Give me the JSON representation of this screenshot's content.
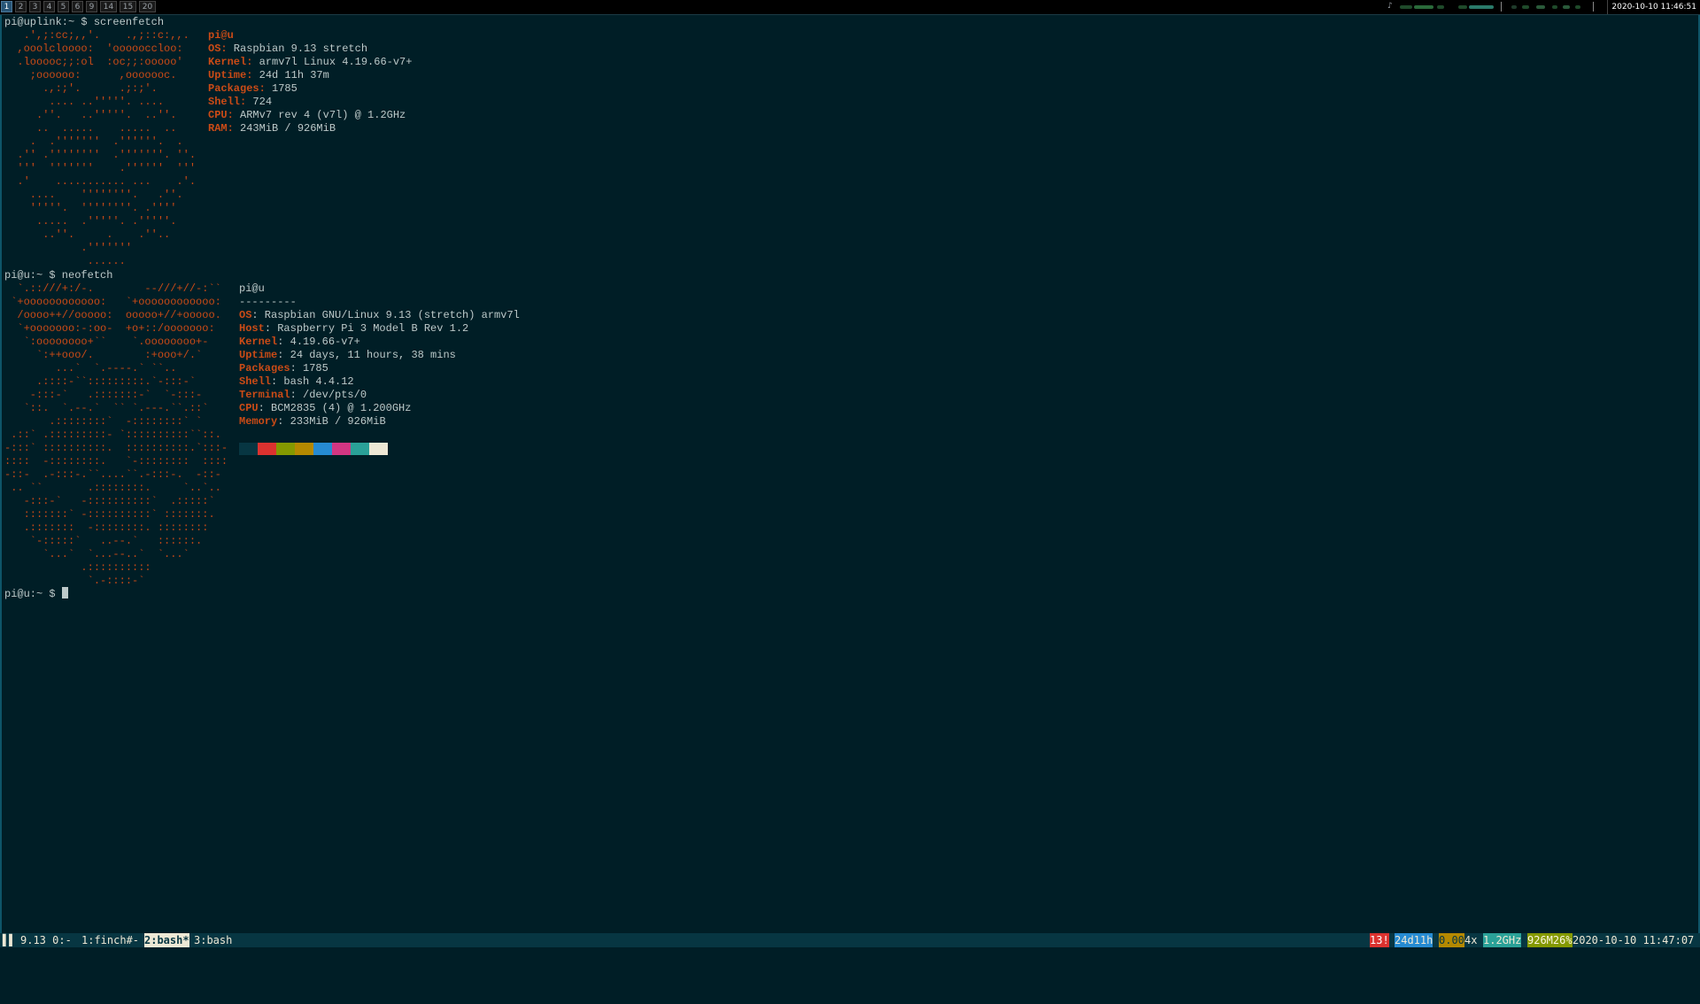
{
  "workspaces": [
    {
      "label": "1",
      "active": true
    },
    {
      "label": "2"
    },
    {
      "label": "3"
    },
    {
      "label": "4"
    },
    {
      "label": "5"
    },
    {
      "label": "6"
    },
    {
      "label": "9"
    },
    {
      "label": "14"
    },
    {
      "label": "15"
    },
    {
      "label": "20"
    }
  ],
  "topbar": {
    "tray_note_icon": "music-note-icon",
    "tray_note": "♪",
    "clock": "2020-10-10 11:46:51"
  },
  "screenfetch": {
    "prompt": "pi@uplink:~ $ screenfetch",
    "art": [
      "   .',;:cc;,,'.    .,;::c:,,.",
      "  ,ooolcloooo:  'oooooccloo:",
      "  .looooc;;:ol  :oc;;:ooooo'",
      "    ;oooooo:      ,ooooooc.",
      "      .,:;'.      .;:;'.",
      "       .... ..'''''. ....",
      "     .''.   ..'''''.  ..''.",
      "     ..  .....    .....  ..",
      "    .  .'''''''  .''''''.  .",
      "  .'' .''''''''  .'''''''. ''.",
      "  '''  '''''''    .''''''  '''",
      "  .'    ........... ...    .'.",
      "    ....    ''''''''.   .''.",
      "    '''''.  ''''''''. .''''",
      "     .....  .'''''. .'''''.",
      "      ..''.     .    .''..",
      "            .'''''''",
      "             ......"
    ],
    "user": "pi@u",
    "info": [
      {
        "label": "OS:",
        "value": " Raspbian 9.13 stretch"
      },
      {
        "label": "Kernel:",
        "value": " armv7l Linux 4.19.66-v7+"
      },
      {
        "label": "Uptime:",
        "value": " 24d 11h 37m"
      },
      {
        "label": "Packages:",
        "value": " 1785"
      },
      {
        "label": "Shell:",
        "value": " 724"
      },
      {
        "label": "CPU:",
        "value": " ARMv7 rev 4 (v7l) @ 1.2GHz"
      },
      {
        "label": "RAM:",
        "value": " 243MiB / 926MiB"
      }
    ]
  },
  "neofetch": {
    "prompt": "pi@u:~ $ neofetch",
    "art": [
      "  `.::///+:/-.        --///+//-:``",
      " `+oooooooooooo:   `+oooooooooooo:",
      "  /oooo++//ooooo:  ooooo+//+ooooo.",
      "  `+ooooooo:-:oo-  +o+::/ooooooo:",
      "   `:oooooooo+``    `.oooooooo+-",
      "     `:++ooo/.        :+ooo+/.`",
      "        ...`  `.----.` ``..",
      "     .::::-``:::::::::.`-:::-`",
      "    -:::-`   .:::::::-`  `-:::-",
      "   `::.  `.--.`  `` `.---.``.::`",
      "       .::::::::`  -::::::::` `",
      " .::` .:::::::::- `::::::::::``::.",
      "-:::` ::::::::::.  ::::::::::.`:::-",
      "::::  -::::::::.   `-::::::::  ::::",
      "-::-  .-:::-.``....``.-:::-.  -::-",
      " .. ``       .::::::::.     `..`..",
      "   -:::-`   -::::::::::`  .:::::`",
      "   :::::::` -::::::::::` :::::::.",
      "   .:::::::  -::::::::. ::::::::",
      "    `-:::::`   ..--.`   ::::::.",
      "      `...`  `...--..`  `...`",
      "            .::::::::::",
      "             `.-::::-`"
    ],
    "user": "pi@u",
    "separator": "---------",
    "info": [
      {
        "label": "OS",
        "value": ": Raspbian GNU/Linux 9.13 (stretch) armv7l"
      },
      {
        "label": "Host",
        "value": ": Raspberry Pi 3 Model B Rev 1.2"
      },
      {
        "label": "Kernel",
        "value": ": 4.19.66-v7+"
      },
      {
        "label": "Uptime",
        "value": ": 24 days, 11 hours, 38 mins"
      },
      {
        "label": "Packages",
        "value": ": 1785"
      },
      {
        "label": "Shell",
        "value": ": bash 4.4.12"
      },
      {
        "label": "Terminal",
        "value": ": /dev/pts/0"
      },
      {
        "label": "CPU",
        "value": ": BCM2835 (4) @ 1.200GHz"
      },
      {
        "label": "Memory",
        "value": ": 233MiB / 926MiB"
      }
    ],
    "palette": [
      "#073642",
      "#dc322f",
      "#859900",
      "#b58900",
      "#268bd2",
      "#d33682",
      "#2aa198",
      "#eee8d5"
    ]
  },
  "current_prompt": "pi@u:~ $ ",
  "tmux": {
    "left_icon": "bars-icon",
    "left_icon_glyph": "▌▌",
    "session": "9.13 0:-",
    "windows": [
      {
        "label": "1:finch#-",
        "active": false
      },
      {
        "label": "2:bash*",
        "active": true
      },
      {
        "label": "3:bash",
        "active": false
      }
    ],
    "status": [
      {
        "text": "13!",
        "bg": "#dc322f",
        "fg": "#ffffff"
      },
      {
        "text": "24d11h",
        "bg": "#268bd2",
        "fg": "#eee8d5"
      },
      {
        "text": "0.00",
        "bg": "#b58900",
        "fg": "#073642"
      },
      {
        "text": "4x",
        "bg": "#073642",
        "fg": "#eee8d5"
      },
      {
        "text": "1.2GHz",
        "bg": "#2aa198",
        "fg": "#eee8d5"
      },
      {
        "text": "926M26%",
        "bg": "#859900",
        "fg": "#fdf6e3"
      },
      {
        "text": "2020-10-10 11:47:07",
        "bg": "#073642",
        "fg": "#eee8d5"
      }
    ]
  }
}
